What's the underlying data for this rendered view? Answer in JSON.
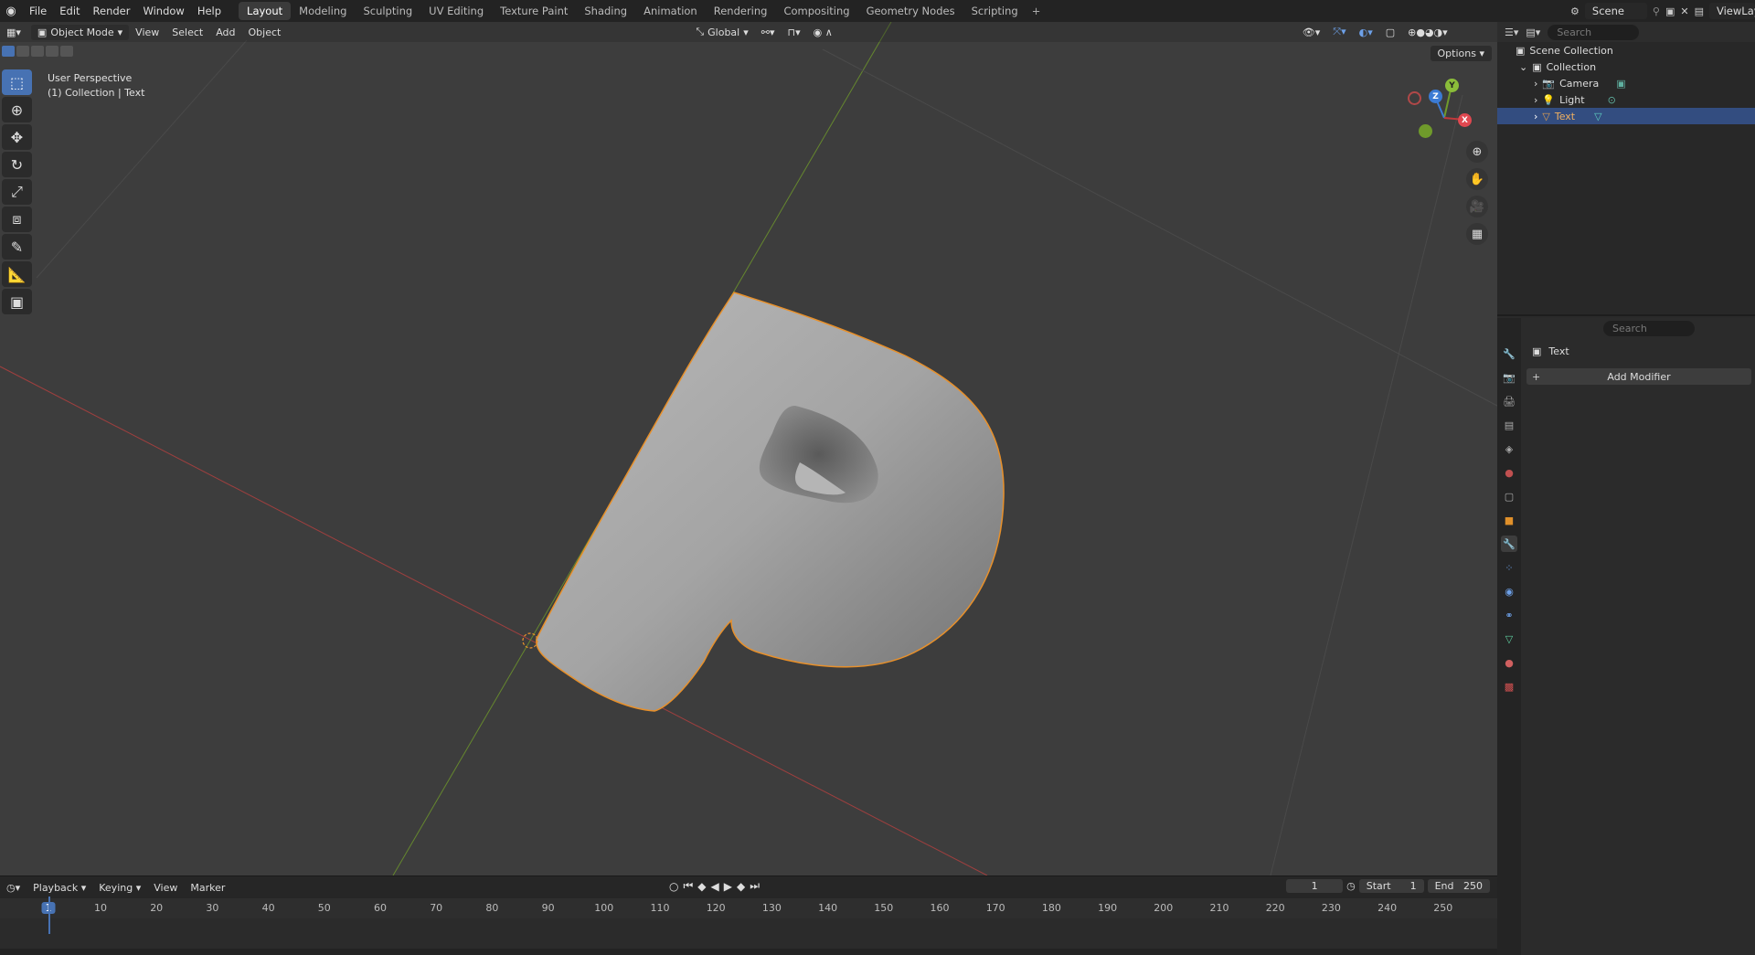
{
  "menu": [
    "File",
    "Edit",
    "Render",
    "Window",
    "Help"
  ],
  "workspaces": [
    "Layout",
    "Modeling",
    "Sculpting",
    "UV Editing",
    "Texture Paint",
    "Shading",
    "Animation",
    "Rendering",
    "Compositing",
    "Geometry Nodes",
    "Scripting"
  ],
  "active_workspace": "Layout",
  "scene_name": "Scene",
  "view_layer": "ViewLaye",
  "viewport": {
    "mode": "Object Mode",
    "menus": [
      "View",
      "Select",
      "Add",
      "Object"
    ],
    "orientation": "Global",
    "perspective_label": "User Perspective",
    "collection_label": "(1) Collection | Text",
    "options_label": "Options"
  },
  "gizmo": {
    "x": "X",
    "y": "Y",
    "z": "Z"
  },
  "outliner": {
    "search_placeholder": "Search",
    "scene_collection": "Scene Collection",
    "collection": "Collection",
    "items": [
      {
        "name": "Camera",
        "icon": "camera-icon",
        "selected": false
      },
      {
        "name": "Light",
        "icon": "light-icon",
        "selected": false
      },
      {
        "name": "Text",
        "icon": "text-object-icon",
        "selected": true
      }
    ]
  },
  "properties": {
    "search_placeholder": "Search",
    "object_name": "Text",
    "add_modifier": "Add Modifier"
  },
  "timeline": {
    "menus": [
      "Playback",
      "Keying",
      "View",
      "Marker"
    ],
    "current_frame": "1",
    "start_label": "Start",
    "start": "1",
    "end_label": "End",
    "end": "250",
    "ticks": [
      "1",
      "10",
      "20",
      "30",
      "40",
      "50",
      "60",
      "70",
      "80",
      "90",
      "100",
      "110",
      "120",
      "130",
      "140",
      "150",
      "160",
      "170",
      "180",
      "190",
      "200",
      "210",
      "220",
      "230",
      "240",
      "250"
    ]
  },
  "colors": {
    "accent": "#4772b3",
    "selection_outline": "#e8902a",
    "axis_x": "#c0393b",
    "axis_y": "#6f9a2b"
  }
}
